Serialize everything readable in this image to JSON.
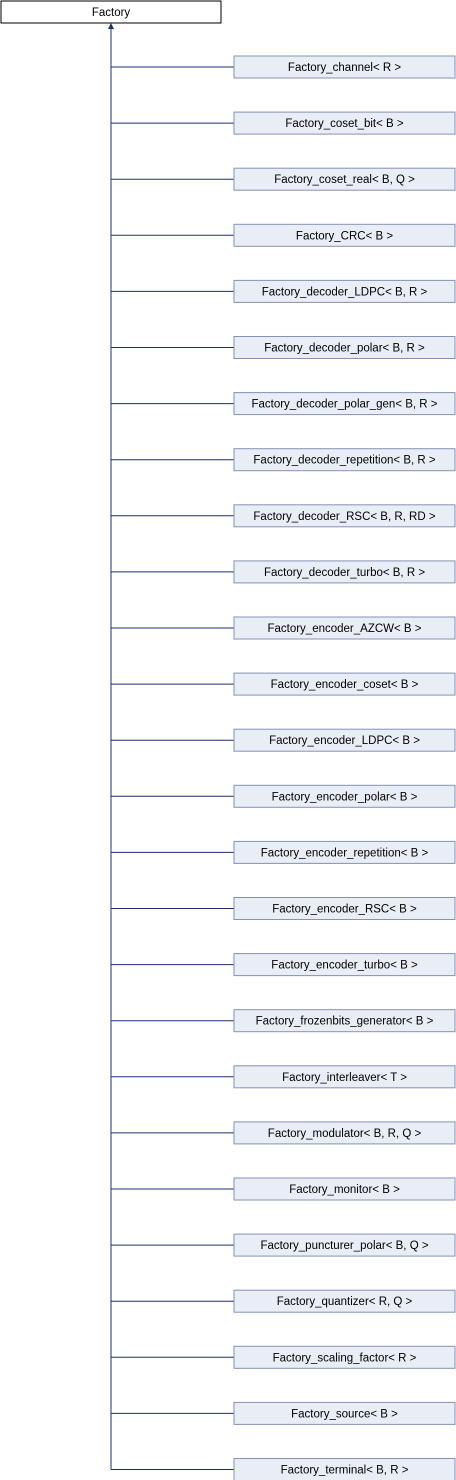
{
  "diagram": {
    "type": "inheritance",
    "base": {
      "label": "Factory"
    },
    "derived": [
      {
        "label": "Factory_channel< R >"
      },
      {
        "label": "Factory_coset_bit< B >"
      },
      {
        "label": "Factory_coset_real< B, Q >"
      },
      {
        "label": "Factory_CRC< B >"
      },
      {
        "label": "Factory_decoder_LDPC< B, R >"
      },
      {
        "label": "Factory_decoder_polar< B, R >"
      },
      {
        "label": "Factory_decoder_polar_gen< B, R >"
      },
      {
        "label": "Factory_decoder_repetition< B, R >"
      },
      {
        "label": "Factory_decoder_RSC< B, R, RD >"
      },
      {
        "label": "Factory_decoder_turbo< B, R >"
      },
      {
        "label": "Factory_encoder_AZCW< B >"
      },
      {
        "label": "Factory_encoder_coset< B >"
      },
      {
        "label": "Factory_encoder_LDPC< B >"
      },
      {
        "label": "Factory_encoder_polar< B >"
      },
      {
        "label": "Factory_encoder_repetition< B >"
      },
      {
        "label": "Factory_encoder_RSC< B >"
      },
      {
        "label": "Factory_encoder_turbo< B >"
      },
      {
        "label": "Factory_frozenbits_generator< B >"
      },
      {
        "label": "Factory_interleaver< T >"
      },
      {
        "label": "Factory_modulator< B, R, Q >"
      },
      {
        "label": "Factory_monitor< B >"
      },
      {
        "label": "Factory_puncturer_polar< B, Q >"
      },
      {
        "label": "Factory_quantizer< R, Q >"
      },
      {
        "label": "Factory_scaling_factor< R >"
      },
      {
        "label": "Factory_source< B >"
      },
      {
        "label": "Factory_terminal< B, R >"
      }
    ],
    "colors": {
      "base_fill": "#ffffff",
      "base_stroke": "#000000",
      "derived_fill": "#e8edf6",
      "derived_stroke": "#8592b6",
      "connector": "#1f2f6e",
      "text": "#000000"
    }
  }
}
